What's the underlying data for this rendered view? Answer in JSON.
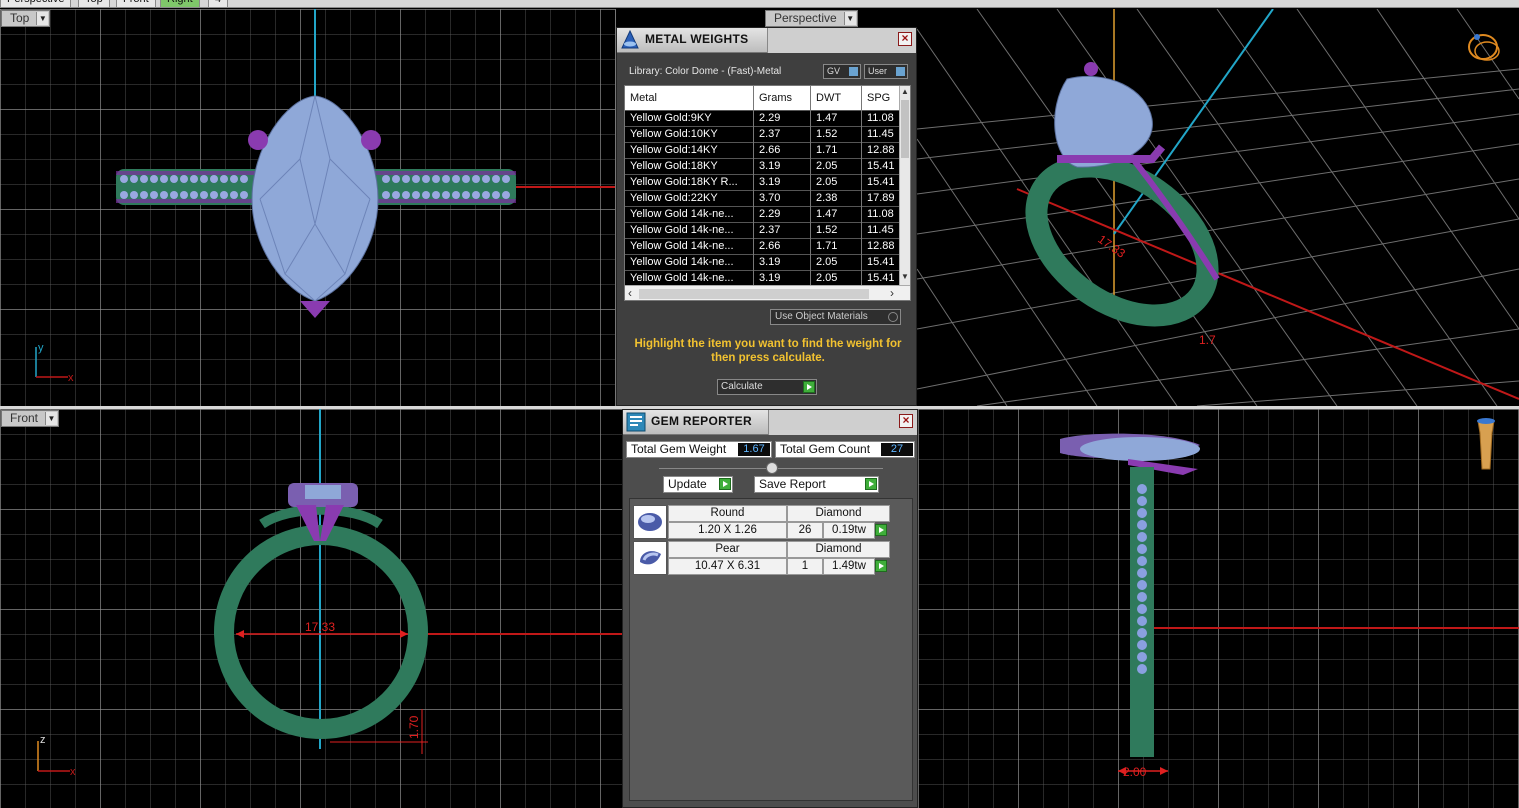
{
  "tabs": [
    "Perspective",
    "Top",
    "Front",
    "Right",
    "4"
  ],
  "viewports": {
    "top": {
      "label": "Top",
      "axis_y": "y",
      "axis_x": "x"
    },
    "perspective": {
      "label": "Perspective",
      "dimension": "17.33",
      "dimension2": "1.7"
    },
    "front": {
      "label": "Front",
      "dimension": "17.33",
      "dimension2": "1.70",
      "axis_z": "z",
      "axis_x": "x"
    },
    "right": {
      "dimension": "2.00"
    }
  },
  "metal_weights": {
    "title": "METAL WEIGHTS",
    "library": "Library: Color Dome - (Fast)-Metal",
    "toggle_gv": "GV",
    "toggle_user": "User",
    "columns": [
      "Metal",
      "Grams",
      "DWT",
      "SPG"
    ],
    "rows": [
      [
        "Yellow Gold:9KY",
        "2.29",
        "1.47",
        "11.08"
      ],
      [
        "Yellow Gold:10KY",
        "2.37",
        "1.52",
        "11.45"
      ],
      [
        "Yellow Gold:14KY",
        "2.66",
        "1.71",
        "12.88"
      ],
      [
        "Yellow Gold:18KY",
        "3.19",
        "2.05",
        "15.41"
      ],
      [
        "Yellow Gold:18KY R...",
        "3.19",
        "2.05",
        "15.41"
      ],
      [
        "Yellow Gold:22KY",
        "3.70",
        "2.38",
        "17.89"
      ],
      [
        "Yellow Gold 14k-ne...",
        "2.29",
        "1.47",
        "11.08"
      ],
      [
        "Yellow Gold 14k-ne...",
        "2.37",
        "1.52",
        "11.45"
      ],
      [
        "Yellow Gold 14k-ne...",
        "2.66",
        "1.71",
        "12.88"
      ],
      [
        "Yellow Gold 14k-ne...",
        "3.19",
        "2.05",
        "15.41"
      ],
      [
        "Yellow Gold 14k-ne...",
        "3.19",
        "2.05",
        "15.41"
      ]
    ],
    "use_object_materials": "Use Object Materials",
    "hint": "Highlight the item you want to find the weight for then press calculate.",
    "calculate": "Calculate"
  },
  "gem_reporter": {
    "title": "GEM REPORTER",
    "total_weight_label": "Total Gem Weight",
    "total_weight": "1.67",
    "total_count_label": "Total Gem Count",
    "total_count": "27",
    "update": "Update",
    "save_report": "Save Report",
    "gems": [
      {
        "shape": "Round",
        "type": "Diamond",
        "size": "1.20 X 1.26",
        "count": "26",
        "weight": "0.19tw"
      },
      {
        "shape": "Pear",
        "type": "Diamond",
        "size": "10.47 X 6.31",
        "count": "1",
        "weight": "1.49tw"
      }
    ]
  },
  "colors": {
    "band": "#2f7a5c",
    "prong": "#7a2fa0",
    "gem": "#8fa8d8",
    "grid": "#8a8a8a",
    "axis_red": "#c01818",
    "axis_cyan": "#22a6c8",
    "hint": "#f2c230"
  }
}
